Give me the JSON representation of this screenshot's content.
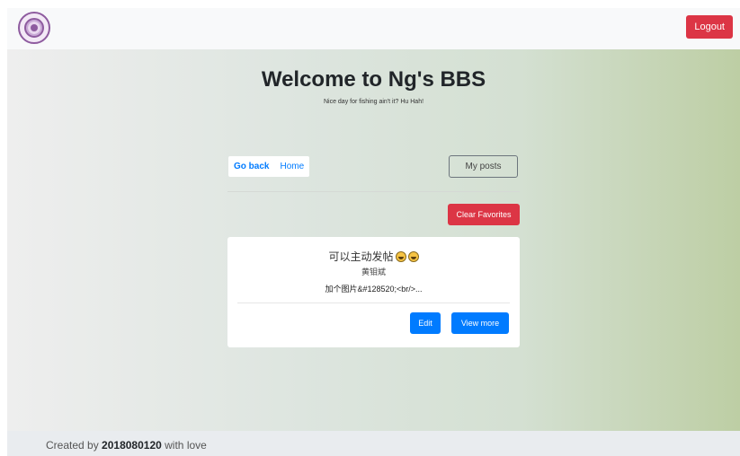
{
  "navbar": {
    "logo_icon": "university-seal-icon",
    "logout_label": "Logout"
  },
  "header": {
    "title": "Welcome to Ng's BBS",
    "subtitle": "Nice day for fishing ain't it? Hu Hah!"
  },
  "tabs": [
    {
      "label": "Go back",
      "active": true
    },
    {
      "label": "Home",
      "active": false
    }
  ],
  "actions": {
    "my_posts_label": "My posts",
    "clear_favorites_label": "Clear Favorites"
  },
  "posts": [
    {
      "title": "可以主动发帖",
      "title_emojis": [
        "grinning-face-icon",
        "grinning-face-icon"
      ],
      "author": "黄钼斌",
      "preview": "加个图片&#128520;<br/>...",
      "edit_label": "Edit",
      "view_more_label": "View more"
    }
  ],
  "footer": {
    "prefix": "Created by",
    "id": "2018080120",
    "suffix": "with love"
  },
  "colors": {
    "primary": "#007bff",
    "danger": "#dc3545",
    "navbar_bg": "#f8f9fa",
    "footer_bg": "#e9ecef"
  }
}
